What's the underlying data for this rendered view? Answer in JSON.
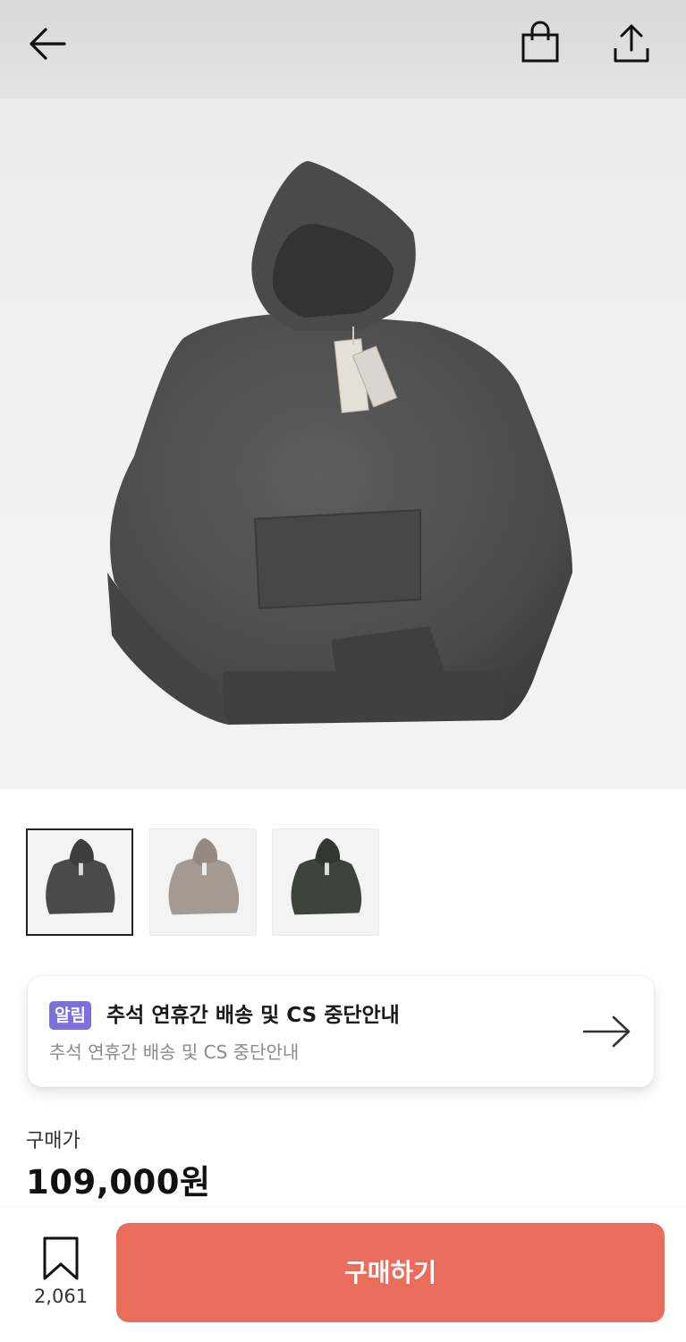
{
  "header": {
    "back_icon": "arrow-left-icon",
    "bag_icon": "shopping-bag-icon",
    "share_icon": "share-icon"
  },
  "product": {
    "main_image": "charcoal-washed-hoodie-jacket",
    "thumbnails": [
      {
        "name": "charcoal",
        "color": "#4a4a4a",
        "selected": true
      },
      {
        "name": "beige",
        "color": "#a59a91",
        "selected": false
      },
      {
        "name": "olive",
        "color": "#3e443d",
        "selected": false
      }
    ]
  },
  "notice": {
    "badge": "알림",
    "title": "추석 연휴간 배송 및 CS 중단안내",
    "subtitle": "추석 연휴간 배송 및 CS 중단안내",
    "arrow_icon": "arrow-right-icon"
  },
  "price": {
    "label": "구매가",
    "value": "109,000원"
  },
  "bottom": {
    "bookmark_icon": "bookmark-icon",
    "bookmark_count": "2,061",
    "buy_label": "구매하기"
  },
  "colors": {
    "accent": "#ea6d5b",
    "badge": "#7d6fe0"
  }
}
